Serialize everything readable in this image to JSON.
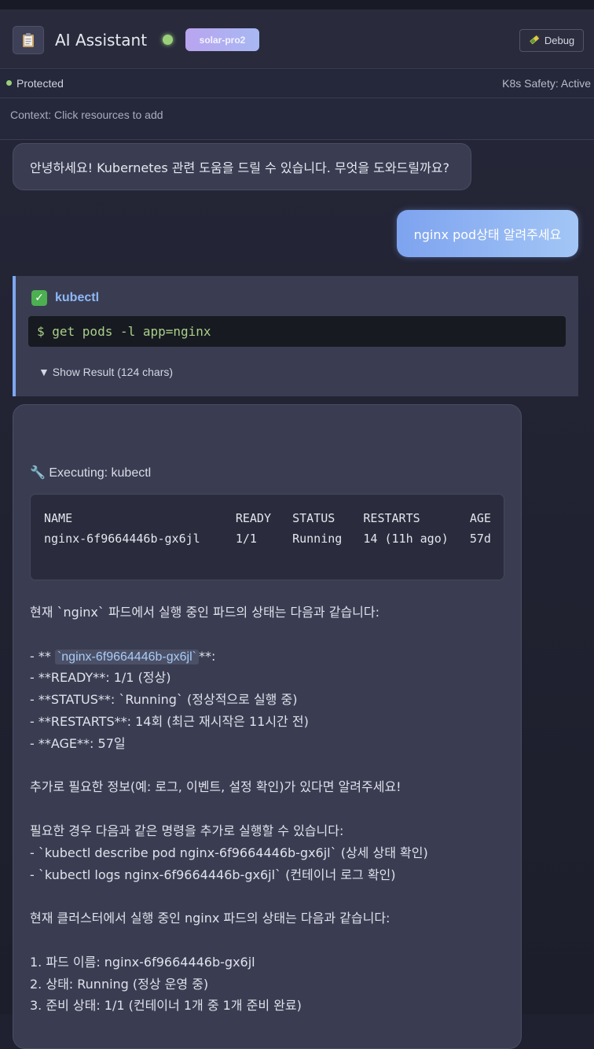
{
  "header": {
    "app_icon": "clipboard-icon",
    "title": "AI Assistant",
    "status_color": "#9ad07a",
    "model": "solar-pro2",
    "debug_label": "Debug"
  },
  "statusbar": {
    "protected": "Protected",
    "safety": "K8s Safety: Active"
  },
  "context": {
    "hint": "Context: Click resources to add"
  },
  "messages": {
    "ai_greeting": "안녕하세요! Kubernetes 관련 도움을 드릴 수 있습니다. 무엇을 도와드릴까요?",
    "user_query": "nginx pod상태 알려주세요",
    "tool": {
      "name": "kubectl",
      "command": "$ get pods -l app=nginx",
      "show_result": "▼ Show Result (124 chars)"
    },
    "response": {
      "executing": "🔧 Executing: kubectl",
      "output_lines": [
        "NAME                       READY   STATUS    RESTARTS       AGE",
        "nginx-6f9664446b-gx6jl     1/1     Running   14 (11h ago)   57d"
      ],
      "lines": [
        "현재 `nginx` 파드에서 실행 중인 파드의 상태는 다음과 같습니다:",
        "",
        "- ** ",
        "- **READY**: 1/1 (정상)",
        "- **STATUS**: `Running` (정상적으로 실행 중)",
        "- **RESTARTS**: 14회 (최근 재시작은 11시간 전)",
        "- **AGE**: 57일",
        "",
        "추가로 필요한 정보(예: 로그, 이벤트, 설정 확인)가 있다면 알려주세요!",
        "",
        "필요한 경우 다음과 같은 명령을 추가로 실행할 수 있습니다:",
        "- `kubectl describe pod nginx-6f9664446b-gx6jl` (상세 상태 확인)",
        "- `kubectl logs nginx-6f9664446b-gx6jl` (컨테이너 로그 확인)",
        "",
        "현재 클러스터에서 실행 중인 nginx 파드의 상태는 다음과 같습니다:",
        "",
        "1. 파드 이름: nginx-6f9664446b-gx6jl",
        "2. 상태: Running (정상 운영 중)",
        "3. 준비 상태: 1/1 (컨테이너 1개 중 1개 준비 완료)"
      ],
      "pod_pill": "`nginx-6f9664446b-gx6jl`",
      "pod_suffix": "**:"
    }
  },
  "colors": {
    "accent_blue": "#7ea7ef",
    "success_green": "#4caf50",
    "user_bubble": "#8fb2f2"
  }
}
